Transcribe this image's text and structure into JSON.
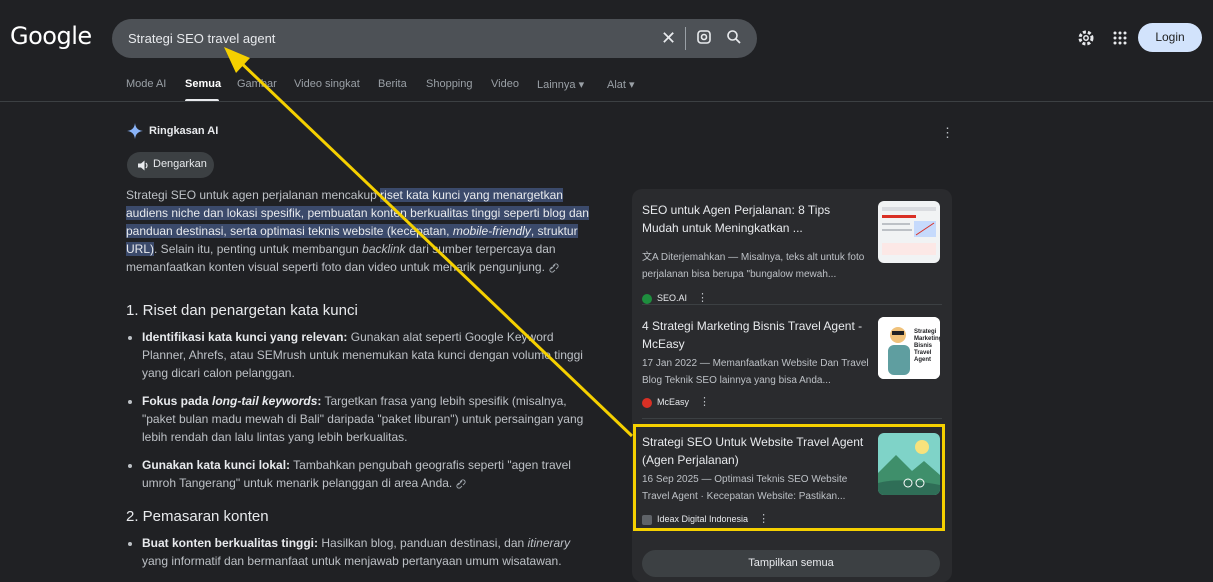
{
  "logo": "Google",
  "search": {
    "query": "Strategi SEO travel agent"
  },
  "header": {
    "login": "Login"
  },
  "tabs": [
    "Mode AI",
    "Semua",
    "Gambar",
    "Video singkat",
    "Berita",
    "Shopping",
    "Video",
    "Lainnya ▾",
    "Alat ▾"
  ],
  "ai": {
    "title": "Ringkasan AI",
    "listen": "Dengarkan",
    "intro_plain": "Strategi SEO untuk agen perjalanan mencakup ",
    "intro_highlight": "riset kata kunci yang menargetkan audiens niche dan lokasi spesifik, pembuatan konten berkualitas tinggi seperti blog dan panduan destinasi, serta optimasi teknis website (kecepatan, ",
    "intro_highlight_em": "mobile-friendly",
    "intro_highlight_tail": ", struktur URL)",
    "intro_after": ". Selain itu, penting untuk membangun ",
    "intro_em": "backlink",
    "intro_end": " dari sumber terpercaya dan memanfaatkan konten visual seperti foto dan video untuk menarik pengunjung.",
    "h1": "1. Riset dan penargetan kata kunci",
    "b1_bold": "Identifikasi kata kunci yang relevan:",
    "b1_text": " Gunakan alat seperti Google Keyword Planner, Ahrefs, atau SEMrush untuk menemukan kata kunci dengan volume tinggi yang dicari calon pelanggan.",
    "b2_bold": "Fokus pada ",
    "b2_em": "long-tail keywords",
    "b2_colon": ":",
    "b2_text": " Targetkan frasa yang lebih spesifik (misalnya, \"paket bulan madu mewah di Bali\" daripada \"paket liburan\") untuk persaingan yang lebih rendah dan lalu lintas yang lebih berkualitas.",
    "b3_bold": "Gunakan kata kunci lokal:",
    "b3_text": " Tambahkan pengubah geografis seperti \"agen travel umroh Tangerang\" untuk menarik pelanggan di area Anda.",
    "h2": "2. Pemasaran konten",
    "b4_bold": "Buat konten berkualitas tinggi:",
    "b4_text": " Hasilkan blog, panduan destinasi, dan ",
    "b4_em": "itinerary",
    "b4_end": " yang informatif dan bermanfaat untuk menjawab pertanyaan umum wisatawan."
  },
  "sources": [
    {
      "title": "SEO untuk Agen Perjalanan: 8 Tips Mudah untuk Meningkatkan ...",
      "snippet": "文A Diterjemahkan — Misalnya, teks alt untuk foto perjalanan bisa berupa \"bungalow mewah...",
      "site": "SEO.AI",
      "fav": "#1e8e3e"
    },
    {
      "title": "4 Strategi Marketing Bisnis Travel Agent - McEasy",
      "snippet": "17 Jan 2022 — Memanfaatkan Website Dan Travel Blog Teknik SEO lainnya yang bisa Anda...",
      "site": "McEasy",
      "fav": "#d93025"
    },
    {
      "title": "Strategi SEO Untuk Website Travel Agent (Agen Perjalanan)",
      "snippet": "16 Sep 2025 — Optimasi Teknis SEO Website Travel Agent · Kecepatan Website: Pastikan...",
      "site": "Ideax Digital Indonesia",
      "fav": "#5f6368"
    }
  ],
  "show_all": "Tampilkan semua",
  "thumb3_text": "Strategi Marketing Bisnis Travel Agent"
}
